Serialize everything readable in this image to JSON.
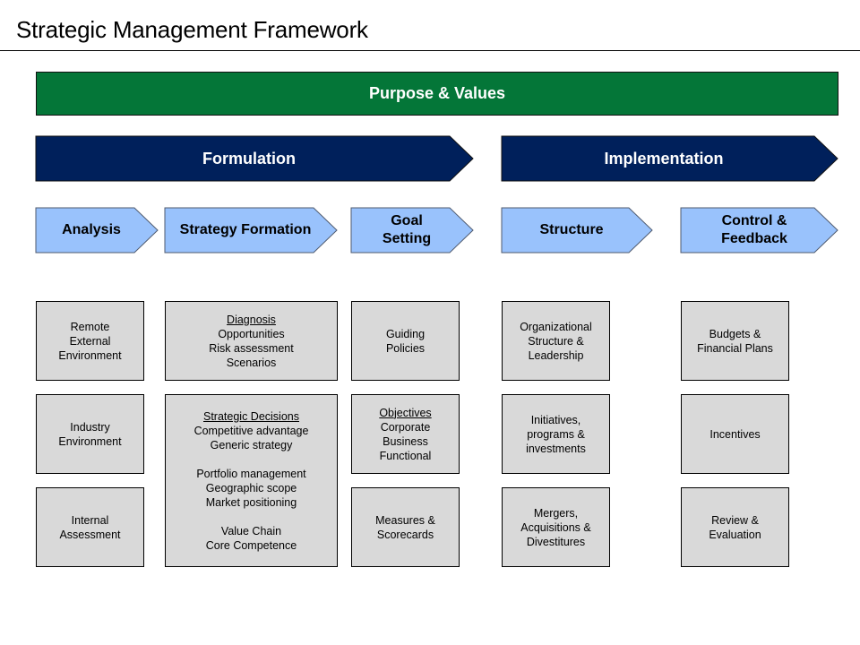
{
  "title": "Strategic Management Framework",
  "colors": {
    "purpose_fill": "#047638",
    "phase_fill": "#00205b",
    "step_fill": "#99c2fc",
    "box_fill": "#d9d9d9"
  },
  "purpose": {
    "label": "Purpose & Values"
  },
  "phases": [
    {
      "label": "Formulation"
    },
    {
      "label": "Implementation"
    }
  ],
  "steps": [
    {
      "label": "Analysis"
    },
    {
      "label": "Strategy Formation"
    },
    {
      "label": "Goal\nSetting"
    },
    {
      "label": "Structure"
    },
    {
      "label": "Control &\nFeedback"
    }
  ],
  "columns": [
    {
      "step": "Analysis",
      "boxes": [
        {
          "lines": [
            {
              "text": "Remote"
            },
            {
              "text": "External"
            },
            {
              "text": "Environment"
            }
          ]
        },
        {
          "lines": [
            {
              "text": "Industry"
            },
            {
              "text": "Environment"
            }
          ]
        },
        {
          "lines": [
            {
              "text": "Internal"
            },
            {
              "text": "Assessment"
            }
          ]
        }
      ]
    },
    {
      "step": "Strategy Formation",
      "boxes": [
        {
          "lines": [
            {
              "text": "Diagnosis",
              "underline": true
            },
            {
              "text": "Opportunities"
            },
            {
              "text": "Risk assessment"
            },
            {
              "text": "Scenarios"
            }
          ]
        },
        {
          "lines": [
            {
              "text": "Strategic Decisions",
              "underline": true
            },
            {
              "text": "Competitive advantage"
            },
            {
              "text": "Generic strategy"
            },
            {
              "text": ""
            },
            {
              "text": "Portfolio management"
            },
            {
              "text": "Geographic scope"
            },
            {
              "text": "Market positioning"
            },
            {
              "text": ""
            },
            {
              "text": "Value Chain"
            },
            {
              "text": "Core Competence"
            }
          ]
        }
      ]
    },
    {
      "step": "Goal Setting",
      "boxes": [
        {
          "lines": [
            {
              "text": "Guiding"
            },
            {
              "text": "Policies"
            }
          ]
        },
        {
          "lines": [
            {
              "text": "Objectives",
              "underline": true
            },
            {
              "text": "Corporate"
            },
            {
              "text": "Business"
            },
            {
              "text": "Functional"
            }
          ]
        },
        {
          "lines": [
            {
              "text": "Measures &"
            },
            {
              "text": "Scorecards"
            }
          ]
        }
      ]
    },
    {
      "step": "Structure",
      "boxes": [
        {
          "lines": [
            {
              "text": "Organizational"
            },
            {
              "text": "Structure &"
            },
            {
              "text": "Leadership"
            }
          ]
        },
        {
          "lines": [
            {
              "text": "Initiatives,"
            },
            {
              "text": "programs &"
            },
            {
              "text": "investments"
            }
          ]
        },
        {
          "lines": [
            {
              "text": "Mergers,"
            },
            {
              "text": "Acquisitions &"
            },
            {
              "text": "Divestitures"
            }
          ]
        }
      ]
    },
    {
      "step": "Control & Feedback",
      "boxes": [
        {
          "lines": [
            {
              "text": "Budgets &"
            },
            {
              "text": "Financial Plans"
            }
          ]
        },
        {
          "lines": [
            {
              "text": "Incentives"
            }
          ]
        },
        {
          "lines": [
            {
              "text": "Review &"
            },
            {
              "text": "Evaluation"
            }
          ]
        }
      ]
    }
  ]
}
